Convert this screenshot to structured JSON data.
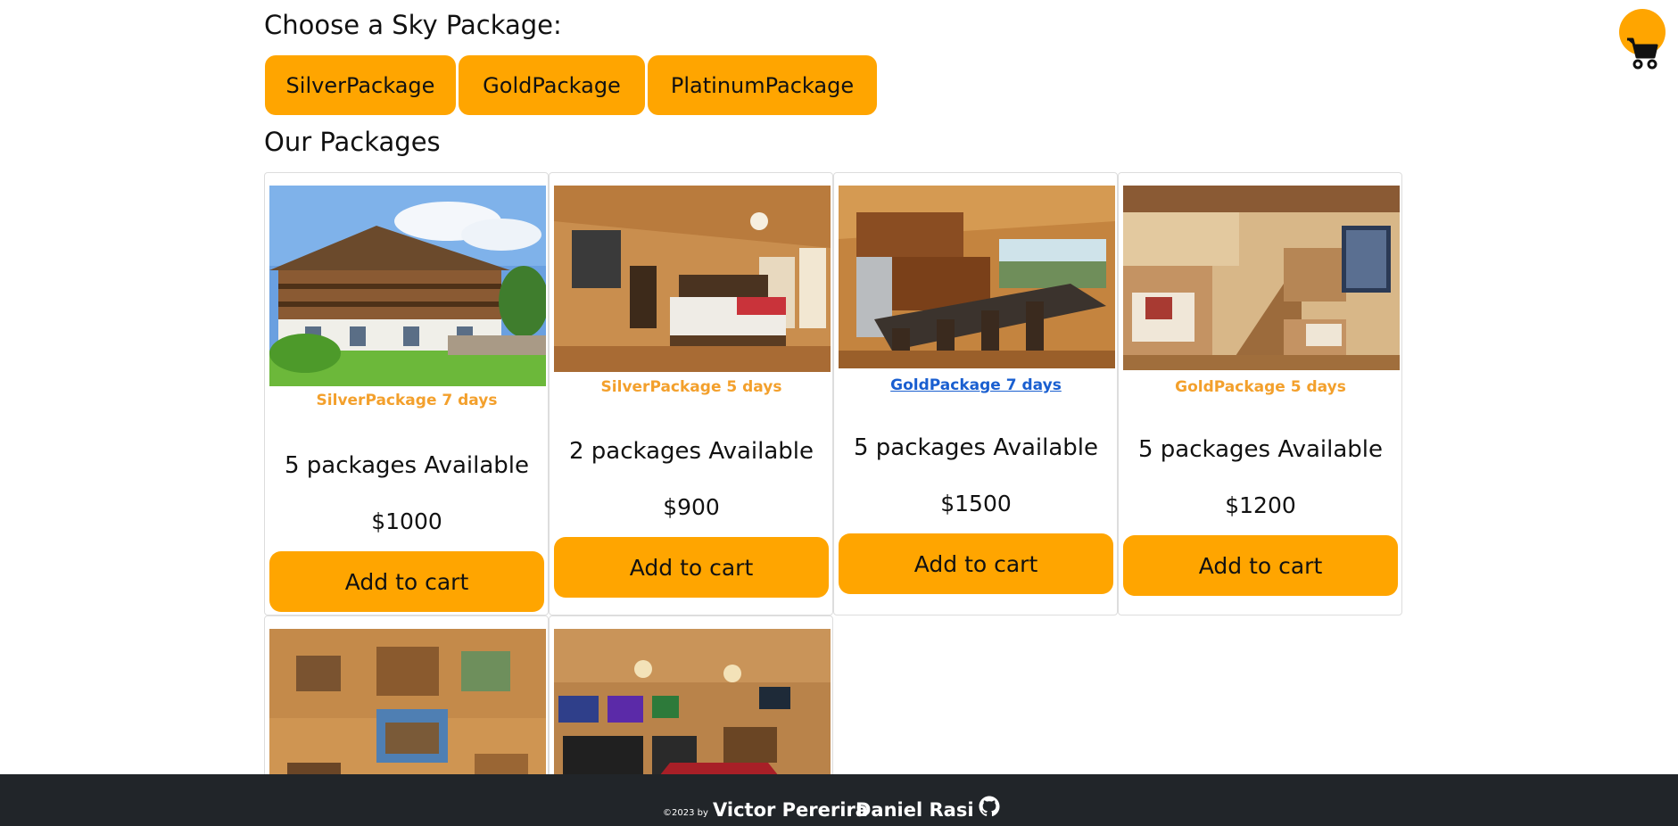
{
  "header": {
    "choose_title": "Choose a Sky Package:",
    "packages_title": "Our Packages"
  },
  "package_filters": [
    "SilverPackage",
    "GoldPackage",
    "PlatinumPackage"
  ],
  "cards": [
    {
      "title": "SilverPackage 7 days",
      "availability": "5 packages Available",
      "price": "$1000",
      "button": "Add to cart",
      "image": "chalet-exterior-photo"
    },
    {
      "title": "SilverPackage 5 days",
      "availability": "2 packages Available",
      "price": "$900",
      "button": "Add to cart",
      "image": "cabin-bedroom-photo"
    },
    {
      "title": "GoldPackage 7 days",
      "availability": "5 packages Available",
      "price": "$1500",
      "button": "Add to cart",
      "image": "cabin-kitchen-photo"
    },
    {
      "title": "GoldPackage 5 days",
      "availability": "5 packages Available",
      "price": "$1200",
      "button": "Add to cart",
      "image": "bunk-room-photo"
    },
    {
      "image": "cabin-collage-photo"
    },
    {
      "image": "game-room-photo"
    }
  ],
  "cart": {
    "icon": "cart-icon"
  },
  "footer": {
    "copyright": "©2023 by",
    "authors": [
      "Victor Pererira",
      "Daniel Rasi"
    ],
    "github_icon": "github-icon"
  },
  "colors": {
    "accent": "#ffa500",
    "card_title": "#f3a02c",
    "link": "#1a5fd0",
    "footer_bg": "#212529"
  }
}
